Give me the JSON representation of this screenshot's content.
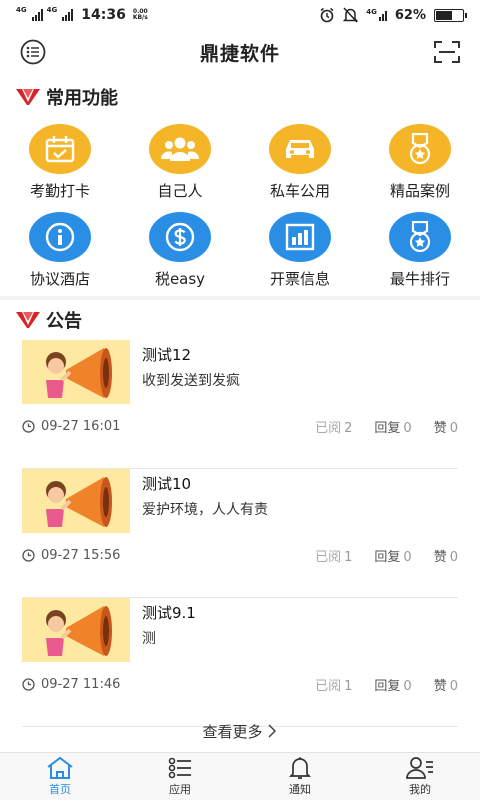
{
  "status": {
    "net1": "4G",
    "net2": "4G",
    "time": "14:36",
    "speed_value": "0.00",
    "speed_unit": "KB/s",
    "net3": "4G",
    "battery": "62%",
    "battery_level": 0.62
  },
  "header": {
    "title": "鼎捷软件"
  },
  "functions": {
    "title": "常用功能",
    "items": [
      {
        "label": "考勤打卡",
        "icon": "calendar-check-icon",
        "color": "#f5b528"
      },
      {
        "label": "自己人",
        "icon": "people-icon",
        "color": "#f5b528"
      },
      {
        "label": "私车公用",
        "icon": "car-icon",
        "color": "#f5b528"
      },
      {
        "label": "精品案例",
        "icon": "medal-icon",
        "color": "#f5b528"
      },
      {
        "label": "协议酒店",
        "icon": "info-icon",
        "color": "#2b8ee5"
      },
      {
        "label": "税easy",
        "icon": "dollar-icon",
        "color": "#2b8ee5"
      },
      {
        "label": "开票信息",
        "icon": "bar-chart-icon",
        "color": "#2b8ee5"
      },
      {
        "label": "最牛排行",
        "icon": "medal-icon",
        "color": "#2b8ee5"
      }
    ]
  },
  "notices": {
    "title": "公告",
    "items": [
      {
        "title": "测试12",
        "body": "收到发送到发疯",
        "time": "09-27 16:01",
        "read_label": "已阅",
        "read": "2",
        "reply_label": "回复",
        "reply": "0",
        "like_label": "赞",
        "like": "0"
      },
      {
        "title": "测试10",
        "body": "爱护环境，人人有责",
        "time": "09-27 15:56",
        "read_label": "已阅",
        "read": "1",
        "reply_label": "回复",
        "reply": "0",
        "like_label": "赞",
        "like": "0"
      },
      {
        "title": "测试9.1",
        "body": "测",
        "time": "09-27 11:46",
        "read_label": "已阅",
        "read": "1",
        "reply_label": "回复",
        "reply": "0",
        "like_label": "赞",
        "like": "0"
      }
    ],
    "more": "查看更多"
  },
  "tabs": [
    {
      "label": "首页",
      "icon": "home-icon",
      "active": true
    },
    {
      "label": "应用",
      "icon": "apps-list-icon",
      "active": false
    },
    {
      "label": "通知",
      "icon": "bell-icon",
      "active": false
    },
    {
      "label": "我的",
      "icon": "user-icon",
      "active": false
    }
  ]
}
